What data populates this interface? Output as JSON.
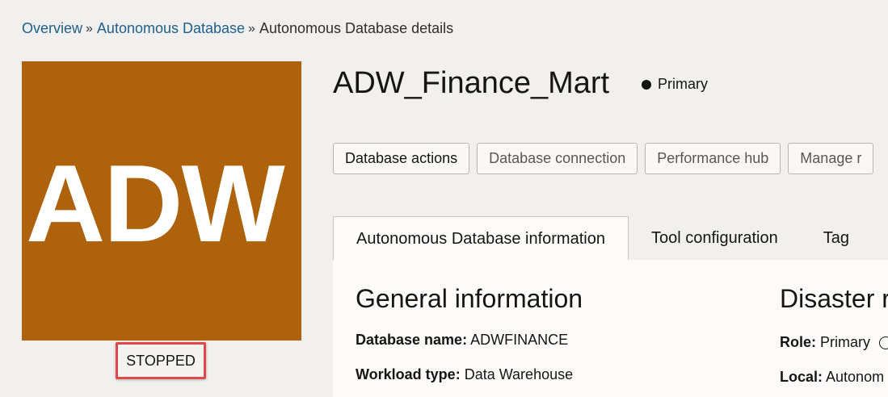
{
  "breadcrumb": {
    "items": [
      "Overview",
      "Autonomous Database"
    ],
    "separator": "»",
    "current": "Autonomous Database details"
  },
  "database": {
    "tile_text": "ADW",
    "tile_color": "#ae620b",
    "state": "STOPPED",
    "state_highlight_color": "#e0474c",
    "name": "ADW_Finance_Mart",
    "role": "Primary"
  },
  "actions": [
    "Database actions",
    "Database connection",
    "Performance hub",
    "Manage r"
  ],
  "tabs": [
    "Autonomous Database information",
    "Tool configuration",
    "Tag"
  ],
  "general_info": {
    "heading": "General information",
    "database_name_label": "Database name:",
    "database_name_value": "ADWFINANCE",
    "workload_type_label": "Workload type:",
    "workload_type_value": "Data Warehouse"
  },
  "disaster_recovery": {
    "heading": "Disaster r",
    "role_label": "Role:",
    "role_value": "Primary",
    "local_label": "Local:",
    "local_value": "Autonom"
  }
}
